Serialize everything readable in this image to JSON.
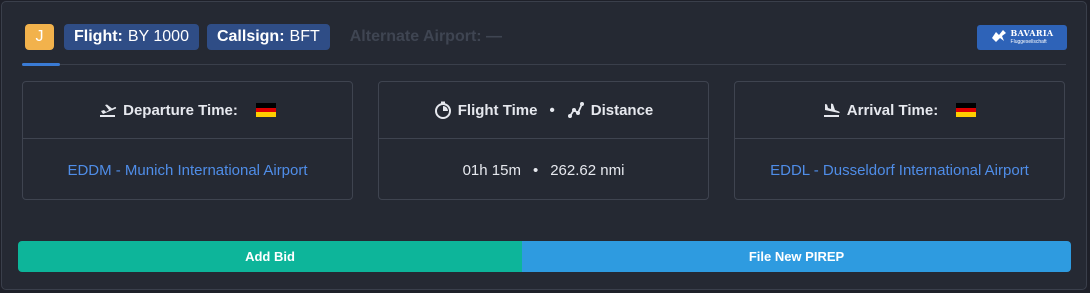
{
  "header": {
    "rank_badge": "J",
    "flight_label": "Flight:",
    "flight_value": "BY 1000",
    "callsign_label": "Callsign:",
    "callsign_value": "BFT",
    "alternate_label": "Alternate Airport: —",
    "logo_title": "BAVARIA",
    "logo_subtitle": "Fluggesellschaft"
  },
  "departure": {
    "title": "Departure Time:",
    "airport": "EDDM - Munich International Airport",
    "flag_icon": "germany-flag"
  },
  "flight": {
    "time_label": "Flight Time",
    "separator": "•",
    "distance_label": "Distance",
    "time_value": "01h 15m",
    "distance_value": "262.62 nmi"
  },
  "arrival": {
    "title": "Arrival Time:",
    "airport": "EDDL - Dusseldorf International Airport",
    "flag_icon": "germany-flag"
  },
  "buttons": {
    "add_bid": "Add Bid",
    "file_pirep": "File New PIREP"
  },
  "colors": {
    "accent": "#3a7bd5",
    "badge": "#f2b24c",
    "tag": "#2f4d86",
    "bid_button": "#0db59a",
    "pirep_button": "#2e9be0",
    "link": "#4f8de8"
  }
}
